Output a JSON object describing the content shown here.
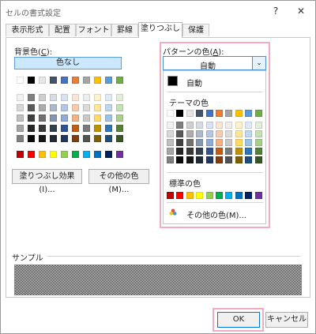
{
  "title": "セルの書式設定",
  "titlebar": {
    "help": "?",
    "close": "✕"
  },
  "tabs": [
    "表示形式",
    "配置",
    "フォント",
    "罫線",
    "塗りつぶし",
    "保護"
  ],
  "background": {
    "label_prefix": "背景色(",
    "label_key": "C",
    "label_suffix": "):",
    "no_color": "色なし",
    "fill_effects": "塗りつぶし効果(I)...",
    "more_colors": "その他の色(M)..."
  },
  "pattern": {
    "label_prefix": "パターンの色(",
    "label_key": "A",
    "label_suffix": "):",
    "selected": "自動",
    "auto": "自動",
    "theme_label": "テーマの色",
    "standard_label": "標準の色",
    "more_colors": "その他の色(M)..."
  },
  "sample_label": "サンプル",
  "ok": "OK",
  "cancel": "キャンセル",
  "colors": {
    "theme_top": [
      "#ffffff",
      "#000000",
      "#e7e6e6",
      "#44546a",
      "#4472c4",
      "#ed7d31",
      "#a5a5a5",
      "#ffc000",
      "#5b9bd5",
      "#70ad47"
    ],
    "theme_tints": [
      [
        "#f2f2f2",
        "#7f7f7f",
        "#d0cece",
        "#d6dce4",
        "#d9e2f3",
        "#fbe5d5",
        "#ededed",
        "#fff2cc",
        "#deebf6",
        "#e2efd9"
      ],
      [
        "#d8d8d8",
        "#595959",
        "#aeabab",
        "#adb9ca",
        "#b4c6e7",
        "#f7cbac",
        "#dbdbdb",
        "#fee599",
        "#bdd7ee",
        "#c5e0b3"
      ],
      [
        "#bfbfbf",
        "#3f3f3f",
        "#757070",
        "#8496b0",
        "#8eaadb",
        "#f4b183",
        "#c9c9c9",
        "#ffd965",
        "#9cc3e5",
        "#a8d08d"
      ],
      [
        "#a5a5a5",
        "#262626",
        "#3a3838",
        "#323f4f",
        "#2f5496",
        "#c55a11",
        "#7b7b7b",
        "#bf9000",
        "#2e75b5",
        "#538135"
      ],
      [
        "#7f7f7f",
        "#0c0c0c",
        "#171616",
        "#222a35",
        "#1f3864",
        "#833c0b",
        "#525252",
        "#7f6000",
        "#1e4e79",
        "#375623"
      ]
    ],
    "standard": [
      "#c00000",
      "#ff0000",
      "#ffc000",
      "#ffff00",
      "#92d050",
      "#00b050",
      "#00b0f0",
      "#0070c0",
      "#002060",
      "#7030a0"
    ]
  },
  "highlight_color": "#f4aac6",
  "accent": "#4a8fd4"
}
